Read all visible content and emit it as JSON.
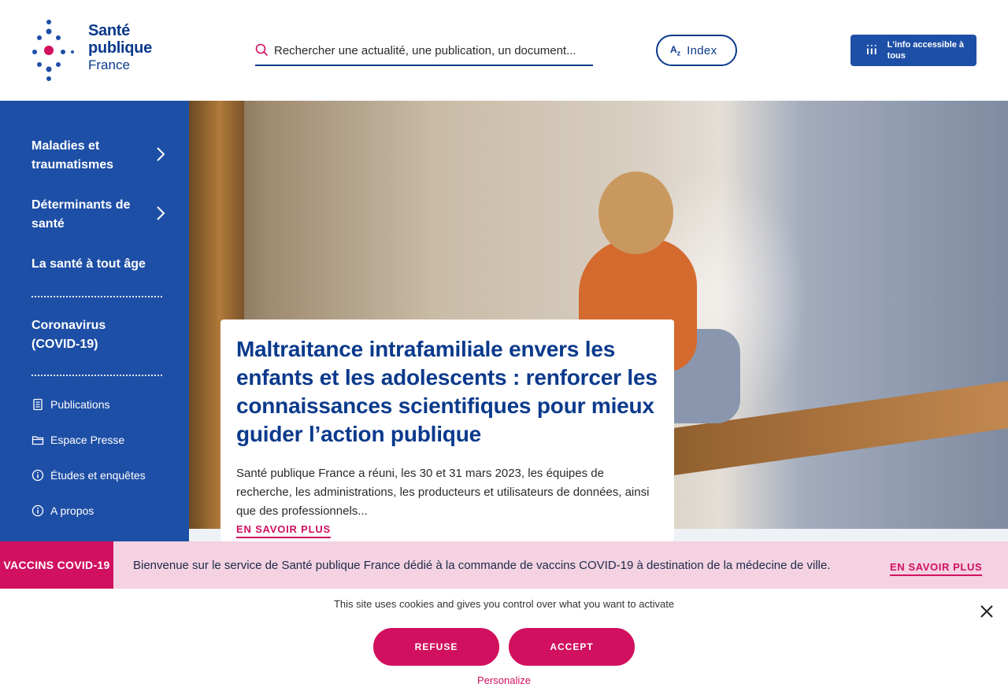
{
  "header": {
    "logo": {
      "line1": "Santé",
      "line2": "publique",
      "line3": "France"
    },
    "search": {
      "placeholder": "Rechercher une actualité, une publication, un document..."
    },
    "index_label": "Index",
    "index_icon": "az-icon",
    "accessibility_label": "L'info accessible à tous",
    "accessibility_icon": "accessibility-icon"
  },
  "sidebar": {
    "items": [
      {
        "label": "Maladies et traumatismes",
        "has_submenu": true
      },
      {
        "label": "Déterminants de santé",
        "has_submenu": true
      },
      {
        "label": "La santé à tout âge",
        "has_submenu": false
      },
      {
        "label": "Coronavirus (COVID-19)",
        "has_submenu": false
      }
    ],
    "links": [
      {
        "label": "Publications",
        "icon": "document-icon"
      },
      {
        "label": "Espace Presse",
        "icon": "folder-icon"
      },
      {
        "label": "Études et enquêtes",
        "icon": "info-icon"
      },
      {
        "label": "A propos",
        "icon": "info-icon"
      }
    ]
  },
  "hero": {
    "title": "Maltraitance intrafamiliale envers les enfants et les adolescents : renforcer les connaissances scientifiques pour mieux guider l’action publique",
    "description": "Santé publique France a réuni, les 30 et 31 mars 2023, les équipes de recherche, les administrations, les producteurs et utilisateurs de données, ainsi que des professionnels...",
    "link_label": "EN SAVOIR PLUS"
  },
  "vaccine_banner": {
    "tag": "VACCINS COVID-19",
    "text": "Bienvenue sur le service de Santé publique France dédié à la commande de vaccins COVID-19 à destination de la médecine de ville.",
    "link_label": "EN SAVOIR PLUS"
  },
  "cookies": {
    "text": "This site uses cookies and gives you control over what you want to activate",
    "refuse_label": "REFUSE",
    "accept_label": "ACCEPT",
    "personalize_label": "Personalize"
  },
  "colors": {
    "brand_blue": "#1e4fa6",
    "dark_blue": "#0b3a8c",
    "accent_pink": "#d1105f",
    "banner_pink": "#f4d2e1"
  }
}
